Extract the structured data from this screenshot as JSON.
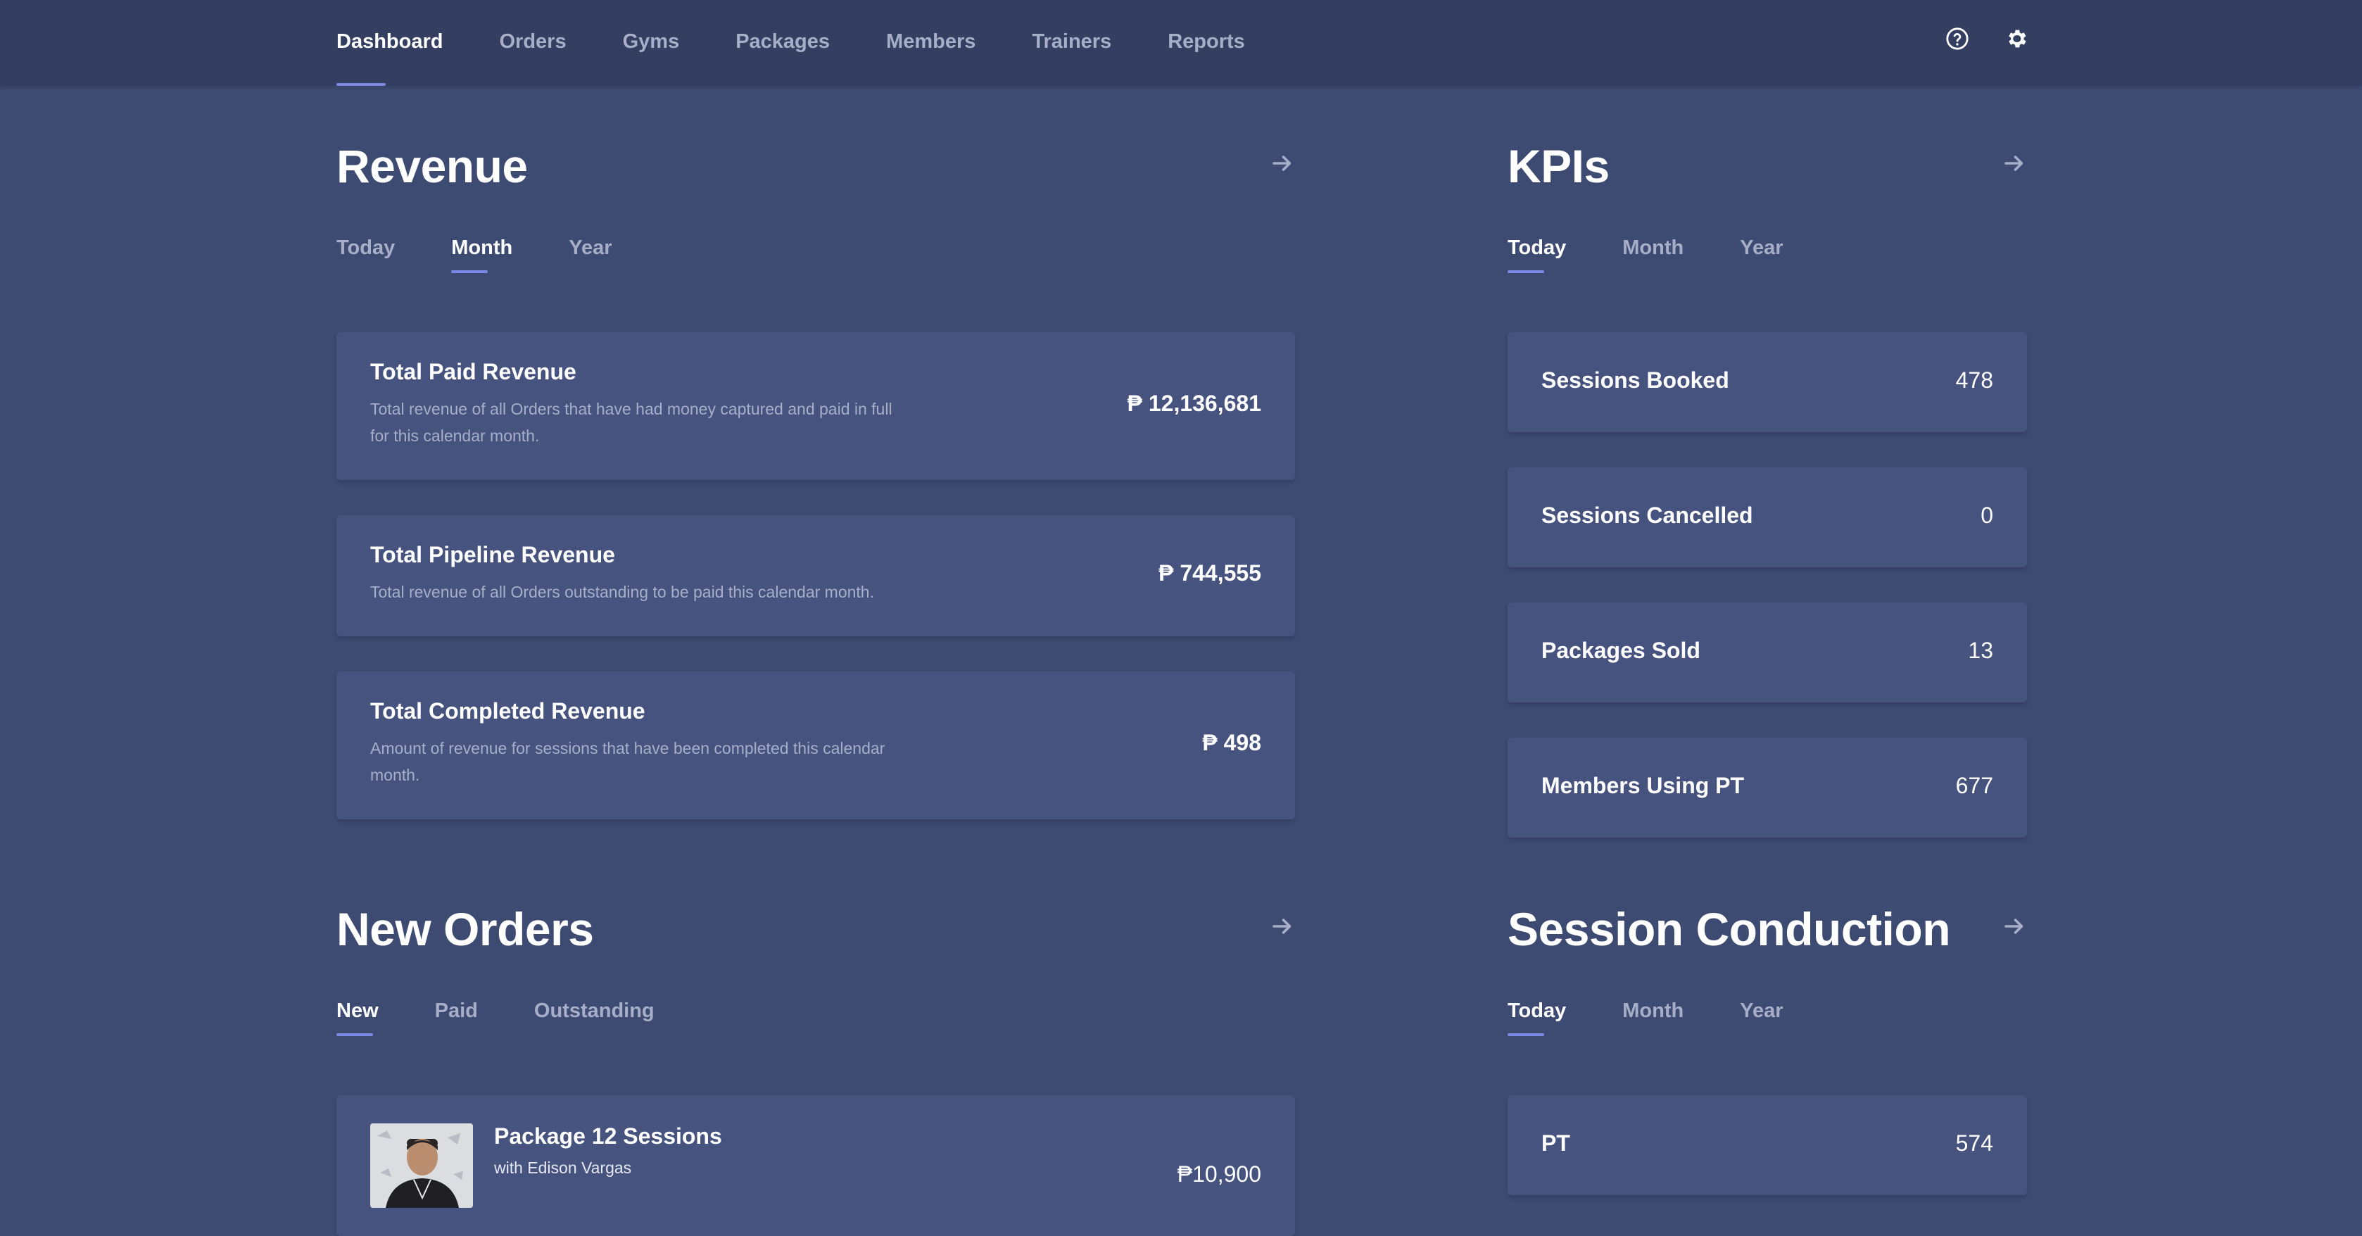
{
  "nav": {
    "items": [
      {
        "label": "Dashboard",
        "active": true
      },
      {
        "label": "Orders",
        "active": false
      },
      {
        "label": "Gyms",
        "active": false
      },
      {
        "label": "Packages",
        "active": false
      },
      {
        "label": "Members",
        "active": false
      },
      {
        "label": "Trainers",
        "active": false
      },
      {
        "label": "Reports",
        "active": false
      }
    ],
    "icons": [
      "help-icon",
      "gear-icon"
    ]
  },
  "colors": {
    "background": "#3d4a72",
    "topbar": "#343e61",
    "card": "#46537f",
    "accent": "#7c8ae6",
    "muted_text": "#a7aec8"
  },
  "revenue": {
    "title": "Revenue",
    "tabs": [
      "Today",
      "Month",
      "Year"
    ],
    "active_tab": "Month",
    "cards": [
      {
        "title": "Total Paid Revenue",
        "description": "Total revenue of all Orders that have had money captured and paid in full for this calendar month.",
        "value": "₱ 12,136,681"
      },
      {
        "title": "Total Pipeline Revenue",
        "description": "Total revenue of all Orders outstanding to be paid this calendar month.",
        "value": "₱ 744,555"
      },
      {
        "title": "Total Completed Revenue",
        "description": "Amount of revenue for sessions that have been completed this calendar month.",
        "value": "₱ 498"
      }
    ]
  },
  "kpis": {
    "title": "KPIs",
    "tabs": [
      "Today",
      "Month",
      "Year"
    ],
    "active_tab": "Today",
    "items": [
      {
        "label": "Sessions Booked",
        "value": "478"
      },
      {
        "label": "Sessions Cancelled",
        "value": "0"
      },
      {
        "label": "Packages Sold",
        "value": "13"
      },
      {
        "label": "Members Using PT",
        "value": "677"
      }
    ]
  },
  "new_orders": {
    "title": "New Orders",
    "tabs": [
      "New",
      "Paid",
      "Outstanding"
    ],
    "active_tab": "New",
    "orders": [
      {
        "package": "Package 12 Sessions",
        "trainer": "with Edison Vargas",
        "price": "₱10,900"
      }
    ]
  },
  "session_conduction": {
    "title": "Session Conduction",
    "tabs": [
      "Today",
      "Month",
      "Year"
    ],
    "active_tab": "Today",
    "items": [
      {
        "label": "PT",
        "value": "574"
      }
    ]
  }
}
